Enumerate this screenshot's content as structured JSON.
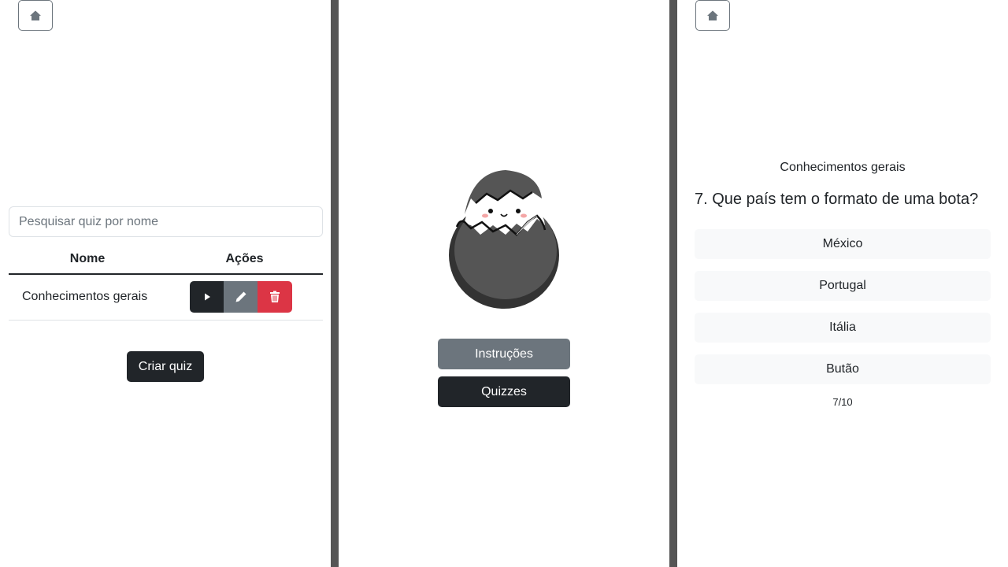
{
  "left": {
    "home_icon": "house-icon",
    "search": {
      "placeholder": "Pesquisar quiz por nome",
      "value": ""
    },
    "table": {
      "headers": [
        "Nome",
        "Ações"
      ],
      "rows": [
        {
          "name": "Conhecimentos gerais"
        }
      ]
    },
    "actions": {
      "play_icon": "play-icon",
      "edit_icon": "pencil-icon",
      "delete_icon": "trash-icon"
    },
    "create_label": "Criar quiz"
  },
  "middle": {
    "mascot": "cracked-egg-mascot",
    "instructions_label": "Instruções",
    "quizzes_label": "Quizzes"
  },
  "right": {
    "home_icon": "house-icon",
    "quiz_title": "Conhecimentos gerais",
    "question": "7. Que país tem o formato de uma bota?",
    "options": [
      "México",
      "Portugal",
      "Itália",
      "Butão"
    ],
    "progress": "7/10"
  },
  "colors": {
    "dark": "#212529",
    "secondary": "#6c757d",
    "danger": "#dc3545",
    "light": "#f8f9fa",
    "divider": "#555555"
  }
}
